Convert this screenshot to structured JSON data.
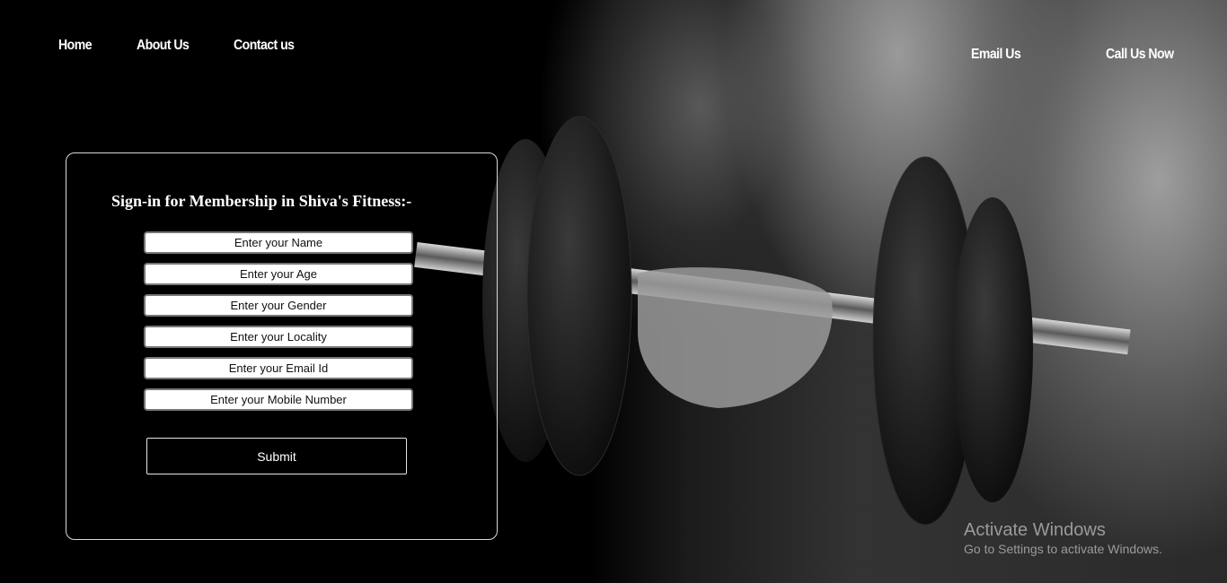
{
  "nav": {
    "left": [
      "Home",
      "About Us",
      "Contact us"
    ],
    "email": "Email Us",
    "call": "Call Us Now"
  },
  "form": {
    "title": "Sign-in for Membership in Shiva's Fitness:-",
    "fields": [
      {
        "placeholder": "Enter your Name"
      },
      {
        "placeholder": "Enter your Age"
      },
      {
        "placeholder": "Enter your Gender"
      },
      {
        "placeholder": "Enter your Locality"
      },
      {
        "placeholder": "Enter your Email Id"
      },
      {
        "placeholder": "Enter your Mobile Number"
      }
    ],
    "submit": "Submit"
  },
  "watermark": {
    "title": "Activate Windows",
    "subtitle": "Go to Settings to activate Windows."
  },
  "colors": {
    "background": "#000000",
    "text": "#ffffff",
    "watermark": "#9a9a9a"
  }
}
